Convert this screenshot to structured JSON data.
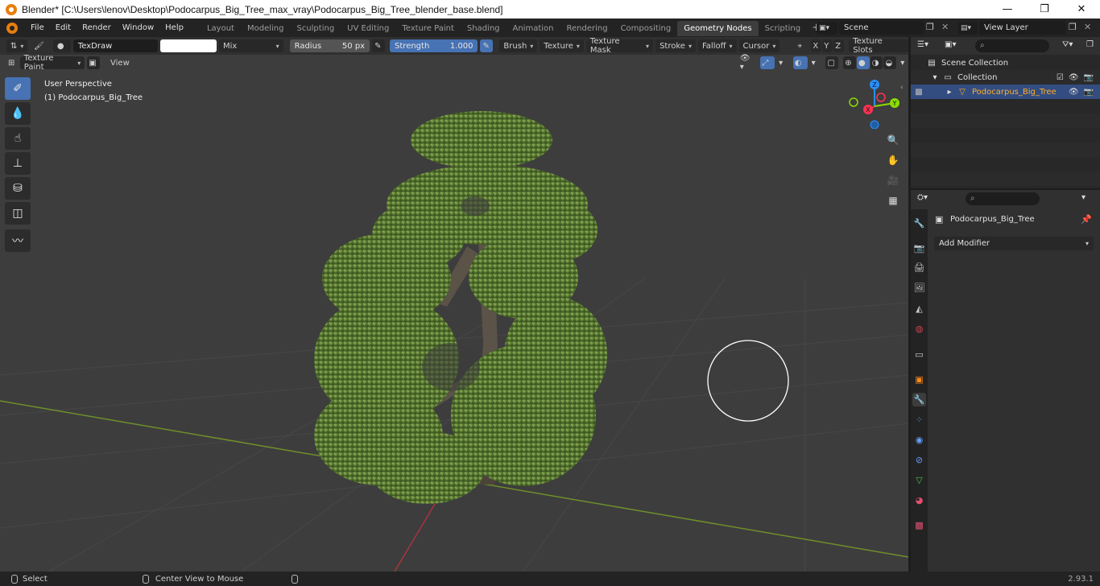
{
  "window": {
    "title": "Blender* [C:\\Users\\lenov\\Desktop\\Podocarpus_Big_Tree_max_vray\\Podocarpus_Big_Tree_blender_base.blend]",
    "minimize": "—",
    "maximize": "❐",
    "close": "✕"
  },
  "menu": [
    "File",
    "Edit",
    "Render",
    "Window",
    "Help"
  ],
  "workspaces": [
    {
      "label": "Layout",
      "active": false
    },
    {
      "label": "Modeling",
      "active": false
    },
    {
      "label": "Sculpting",
      "active": false
    },
    {
      "label": "UV Editing",
      "active": false
    },
    {
      "label": "Texture Paint",
      "active": false
    },
    {
      "label": "Shading",
      "active": false
    },
    {
      "label": "Animation",
      "active": false
    },
    {
      "label": "Rendering",
      "active": false
    },
    {
      "label": "Compositing",
      "active": false
    },
    {
      "label": "Geometry Nodes",
      "active": true
    },
    {
      "label": "Scripting",
      "active": false
    }
  ],
  "workspace_add": "+",
  "scene": {
    "label": "Scene",
    "view_layer": "View Layer"
  },
  "tool_header": {
    "brush_name": "TexDraw",
    "blend_mode": "Mix",
    "radius_label": "Radius",
    "radius_value": "50 px",
    "strength_label": "Strength",
    "strength_value": "1.000",
    "menus": [
      "Brush",
      "Texture",
      "Texture Mask",
      "Stroke",
      "Falloff",
      "Cursor"
    ],
    "axes": [
      "X",
      "Y",
      "Z"
    ],
    "texture_slots": "Texture Slots"
  },
  "viewport_header": {
    "mode": "Texture Paint",
    "view": "View"
  },
  "viewport": {
    "perspective": "User Perspective",
    "object_label": "(1) Podocarpus_Big_Tree",
    "brush_radius_fraction": 0.07
  },
  "gizmo": {
    "x": "X",
    "y": "Y",
    "z": "Z"
  },
  "outliner": {
    "scene_collection": "Scene Collection",
    "collection": "Collection",
    "object": "Podocarpus_Big_Tree"
  },
  "properties": {
    "object_name": "Podocarpus_Big_Tree",
    "add_modifier": "Add Modifier"
  },
  "statusbar": {
    "select": "Select",
    "center_view": "Center View to Mouse",
    "version": "2.93.1"
  },
  "colors": {
    "accent_blue": "#4772b3",
    "selection_row": "#334d80",
    "x_axis": "#ff3352",
    "y_axis": "#8bdc00",
    "z_axis": "#2890ff",
    "active_object": "#ffaf29"
  }
}
